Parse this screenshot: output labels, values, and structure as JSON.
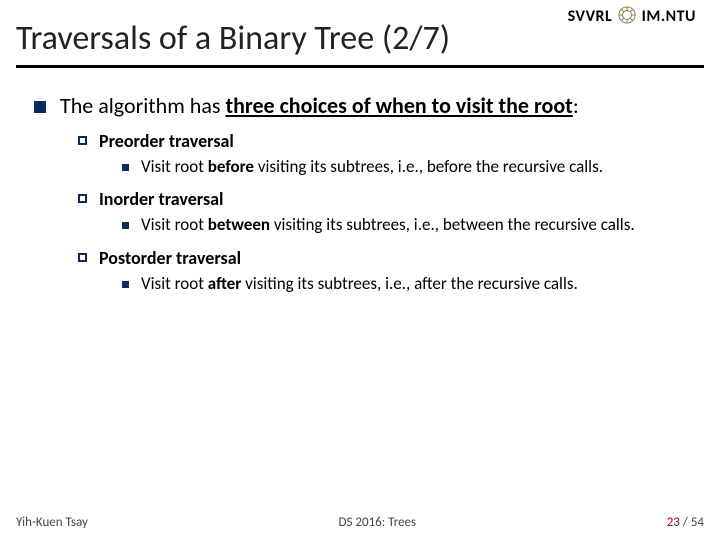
{
  "header": {
    "org_left": "SVVRL",
    "org_right": "IM.NTU",
    "title": "Traversals of a Binary Tree (2/7)"
  },
  "body": {
    "intro_prefix": "The algorithm has ",
    "intro_emph": "three choices of when to  visit the root",
    "intro_suffix": ":",
    "items": [
      {
        "heading": "Preorder traversal",
        "desc_pre": "Visit root ",
        "desc_bold": "before",
        "desc_post": " visiting its subtrees, i.e., before the recursive calls."
      },
      {
        "heading": "Inorder traversal",
        "desc_pre": "Visit root ",
        "desc_bold": "between",
        "desc_post": " visiting its subtrees, i.e., between the recursive calls."
      },
      {
        "heading": "Postorder traversal",
        "desc_pre": "Visit root ",
        "desc_bold": "after",
        "desc_post": " visiting its subtrees, i.e., after the recursive calls."
      }
    ]
  },
  "footer": {
    "author": "Yih-Kuen Tsay",
    "course": "DS 2016: Trees",
    "page_current": "23",
    "page_sep": " / ",
    "page_total": "54"
  }
}
